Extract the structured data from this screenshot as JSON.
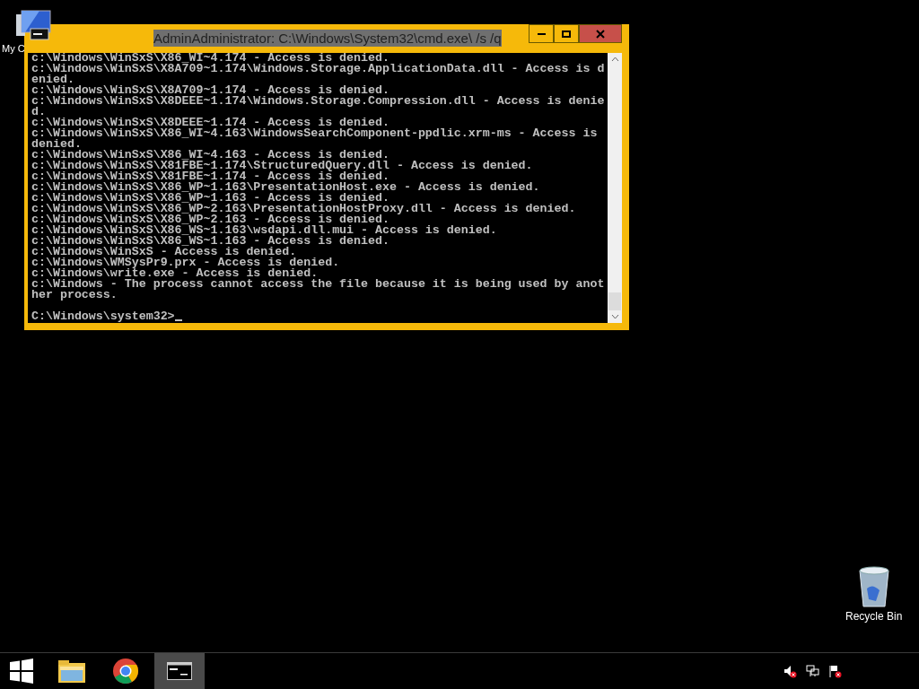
{
  "desktop_icons": [
    {
      "kind": "computer",
      "label": "My C"
    },
    {
      "kind": "recycle",
      "label": "Recycle Bin"
    }
  ],
  "window": {
    "title": "AdminAdministrator: C:\\Windows\\System32\\cmd.exe\\ /s /q",
    "active": true,
    "console": {
      "lines": [
        "c:\\Windows\\WinSxS\\X86_WI~4.174 - Access is denied.",
        "c:\\Windows\\WinSxS\\X8A709~1.174\\Windows.Storage.ApplicationData.dll - Access is d",
        "enied.",
        "c:\\Windows\\WinSxS\\X8A709~1.174 - Access is denied.",
        "c:\\Windows\\WinSxS\\X8DEEE~1.174\\Windows.Storage.Compression.dll - Access is denie",
        "d.",
        "c:\\Windows\\WinSxS\\X8DEEE~1.174 - Access is denied.",
        "c:\\Windows\\WinSxS\\X86_WI~4.163\\WindowsSearchComponent-ppdlic.xrm-ms - Access is",
        "denied.",
        "c:\\Windows\\WinSxS\\X86_WI~4.163 - Access is denied.",
        "c:\\Windows\\WinSxS\\X81FBE~1.174\\StructuredQuery.dll - Access is denied.",
        "c:\\Windows\\WinSxS\\X81FBE~1.174 - Access is denied.",
        "c:\\Windows\\WinSxS\\X86_WP~1.163\\PresentationHost.exe - Access is denied.",
        "c:\\Windows\\WinSxS\\X86_WP~1.163 - Access is denied.",
        "c:\\Windows\\WinSxS\\X86_WP~2.163\\PresentationHostProxy.dll - Access is denied.",
        "c:\\Windows\\WinSxS\\X86_WP~2.163 - Access is denied.",
        "c:\\Windows\\WinSxS\\X86_WS~1.163\\wsdapi.dll.mui - Access is denied.",
        "c:\\Windows\\WinSxS\\X86_WS~1.163 - Access is denied.",
        "c:\\Windows\\WinSxS - Access is denied.",
        "c:\\Windows\\WMSysPr9.prx - Access is denied.",
        "c:\\Windows\\write.exe - Access is denied.",
        "c:\\Windows - The process cannot access the file because it is being used by anot",
        "her process."
      ],
      "prompt": "C:\\Windows\\system32>"
    }
  },
  "taskbar": {
    "items": [
      {
        "kind": "start",
        "active": false
      },
      {
        "kind": "explorer",
        "active": false
      },
      {
        "kind": "browser",
        "active": false
      },
      {
        "kind": "cmd",
        "active": true
      }
    ],
    "tray": [
      {
        "kind": "volume"
      },
      {
        "kind": "network"
      },
      {
        "kind": "flag"
      }
    ]
  }
}
